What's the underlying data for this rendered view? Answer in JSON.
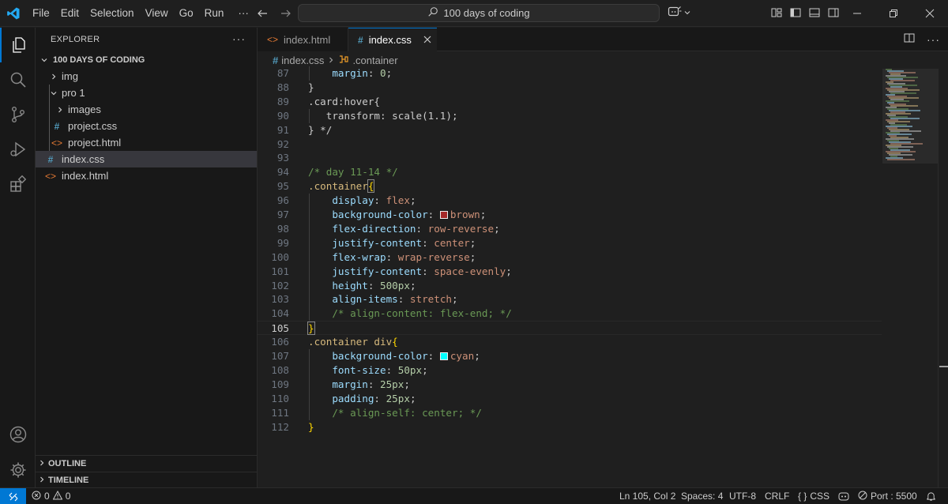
{
  "menu": [
    "File",
    "Edit",
    "Selection",
    "View",
    "Go",
    "Run",
    "···"
  ],
  "search": {
    "text": "100 days of coding"
  },
  "explorer": {
    "title": "EXPLORER",
    "more": "···",
    "folder": "100 DAYS OF CODING",
    "items": [
      {
        "label": "img",
        "type": "folder-collapsed"
      },
      {
        "label": "pro 1",
        "type": "folder-expanded"
      },
      {
        "label": "images",
        "type": "folder-collapsed"
      },
      {
        "label": "project.css",
        "type": "css"
      },
      {
        "label": "project.html",
        "type": "html"
      },
      {
        "label": "index.css",
        "type": "css",
        "selected": true
      },
      {
        "label": "index.html",
        "type": "html"
      }
    ],
    "outline": "OUTLINE",
    "timeline": "TIMELINE"
  },
  "tabs": [
    {
      "label": "index.html",
      "icon": "html-icon",
      "active": false
    },
    {
      "label": "index.css",
      "icon": "css-icon",
      "active": true
    }
  ],
  "breadcrumb": {
    "file": "index.css",
    "symbol": ".container"
  },
  "code": [
    {
      "n": "87",
      "t": [
        [
          "    ",
          ""
        ],
        [
          "margin",
          "k-prop"
        ],
        [
          ": ",
          "k-punc"
        ],
        [
          "0",
          "k-num"
        ],
        [
          ";",
          "k-punc"
        ]
      ],
      "g": 1
    },
    {
      "n": "88",
      "t": [
        [
          "}",
          "k-punc"
        ]
      ]
    },
    {
      "n": "89",
      "t": [
        [
          ".card:hover{",
          "k-punc"
        ]
      ]
    },
    {
      "n": "90",
      "t": [
        [
          "   ",
          ""
        ],
        [
          "transform: scale(1.1);",
          "k-punc"
        ]
      ],
      "g": 1
    },
    {
      "n": "91",
      "t": [
        [
          "} */",
          "k-punc"
        ]
      ]
    },
    {
      "n": "92",
      "t": []
    },
    {
      "n": "93",
      "t": []
    },
    {
      "n": "94",
      "t": [
        [
          "/* day 11-14 */",
          "k-com"
        ]
      ]
    },
    {
      "n": "95",
      "t": [
        [
          ".container",
          "k-sel"
        ],
        [
          "{",
          "k-brace bracket-box"
        ]
      ]
    },
    {
      "n": "96",
      "t": [
        [
          "    ",
          ""
        ],
        [
          "display",
          "k-prop"
        ],
        [
          ": ",
          "k-punc"
        ],
        [
          "flex",
          "k-val"
        ],
        [
          ";",
          "k-punc"
        ]
      ],
      "g": 1
    },
    {
      "n": "97",
      "t": [
        [
          "    ",
          ""
        ],
        [
          "background-color",
          "k-prop"
        ],
        [
          ": ",
          "k-punc"
        ],
        [
          "SW:#a52a2a",
          ""
        ],
        [
          "brown",
          "k-val"
        ],
        [
          ";",
          "k-punc"
        ]
      ],
      "g": 1
    },
    {
      "n": "98",
      "t": [
        [
          "    ",
          ""
        ],
        [
          "flex-direction",
          "k-prop"
        ],
        [
          ": ",
          "k-punc"
        ],
        [
          "row-reverse",
          "k-val"
        ],
        [
          ";",
          "k-punc"
        ]
      ],
      "g": 1
    },
    {
      "n": "99",
      "t": [
        [
          "    ",
          ""
        ],
        [
          "justify-content",
          "k-prop"
        ],
        [
          ": ",
          "k-punc"
        ],
        [
          "center",
          "k-val"
        ],
        [
          ";",
          "k-punc"
        ]
      ],
      "g": 1
    },
    {
      "n": "100",
      "t": [
        [
          "    ",
          ""
        ],
        [
          "flex-wrap",
          "k-prop"
        ],
        [
          ": ",
          "k-punc"
        ],
        [
          "wrap-reverse",
          "k-val"
        ],
        [
          ";",
          "k-punc"
        ]
      ],
      "g": 1
    },
    {
      "n": "101",
      "t": [
        [
          "    ",
          ""
        ],
        [
          "justify-content",
          "k-prop"
        ],
        [
          ": ",
          "k-punc"
        ],
        [
          "space-evenly",
          "k-val"
        ],
        [
          ";",
          "k-punc"
        ]
      ],
      "g": 1
    },
    {
      "n": "102",
      "t": [
        [
          "    ",
          ""
        ],
        [
          "height",
          "k-prop"
        ],
        [
          ": ",
          "k-punc"
        ],
        [
          "500px",
          "k-num"
        ],
        [
          ";",
          "k-punc"
        ]
      ],
      "g": 1
    },
    {
      "n": "103",
      "t": [
        [
          "    ",
          ""
        ],
        [
          "align-items",
          "k-prop"
        ],
        [
          ": ",
          "k-punc"
        ],
        [
          "stretch",
          "k-val"
        ],
        [
          ";",
          "k-punc"
        ]
      ],
      "g": 1
    },
    {
      "n": "104",
      "t": [
        [
          "    ",
          ""
        ],
        [
          "/* align-content: flex-end; */",
          "k-com"
        ]
      ],
      "g": 1
    },
    {
      "n": "105",
      "t": [
        [
          "}",
          "k-brace bracket-box"
        ]
      ],
      "current": true
    },
    {
      "n": "106",
      "t": [
        [
          ".container div",
          "k-sel"
        ],
        [
          "{",
          "k-brace"
        ]
      ]
    },
    {
      "n": "107",
      "t": [
        [
          "    ",
          ""
        ],
        [
          "background-color",
          "k-prop"
        ],
        [
          ": ",
          "k-punc"
        ],
        [
          "SW:#00ffff",
          ""
        ],
        [
          "cyan",
          "k-val"
        ],
        [
          ";",
          "k-punc"
        ]
      ],
      "g": 1
    },
    {
      "n": "108",
      "t": [
        [
          "    ",
          ""
        ],
        [
          "font-size",
          "k-prop"
        ],
        [
          ": ",
          "k-punc"
        ],
        [
          "50px",
          "k-num"
        ],
        [
          ";",
          "k-punc"
        ]
      ],
      "g": 1
    },
    {
      "n": "109",
      "t": [
        [
          "    ",
          ""
        ],
        [
          "margin",
          "k-prop"
        ],
        [
          ": ",
          "k-punc"
        ],
        [
          "25px",
          "k-num"
        ],
        [
          ";",
          "k-punc"
        ]
      ],
      "g": 1
    },
    {
      "n": "110",
      "t": [
        [
          "    ",
          ""
        ],
        [
          "padding",
          "k-prop"
        ],
        [
          ": ",
          "k-punc"
        ],
        [
          "25px",
          "k-num"
        ],
        [
          ";",
          "k-punc"
        ]
      ],
      "g": 1
    },
    {
      "n": "111",
      "t": [
        [
          "    ",
          ""
        ],
        [
          "/* align-self: center; */",
          "k-com"
        ]
      ],
      "g": 1
    },
    {
      "n": "112",
      "t": [
        [
          "}",
          "k-brace"
        ]
      ]
    }
  ],
  "status": {
    "errors": "0",
    "warnings": "0",
    "position": "Ln 105, Col 2",
    "spaces": "Spaces: 4",
    "encoding": "UTF-8",
    "eol": "CRLF",
    "language": "CSS",
    "port": "Port : 5500"
  },
  "colors": {
    "accent": "#0078d4",
    "css_icon": "#519aba",
    "html_icon": "#e37933"
  }
}
